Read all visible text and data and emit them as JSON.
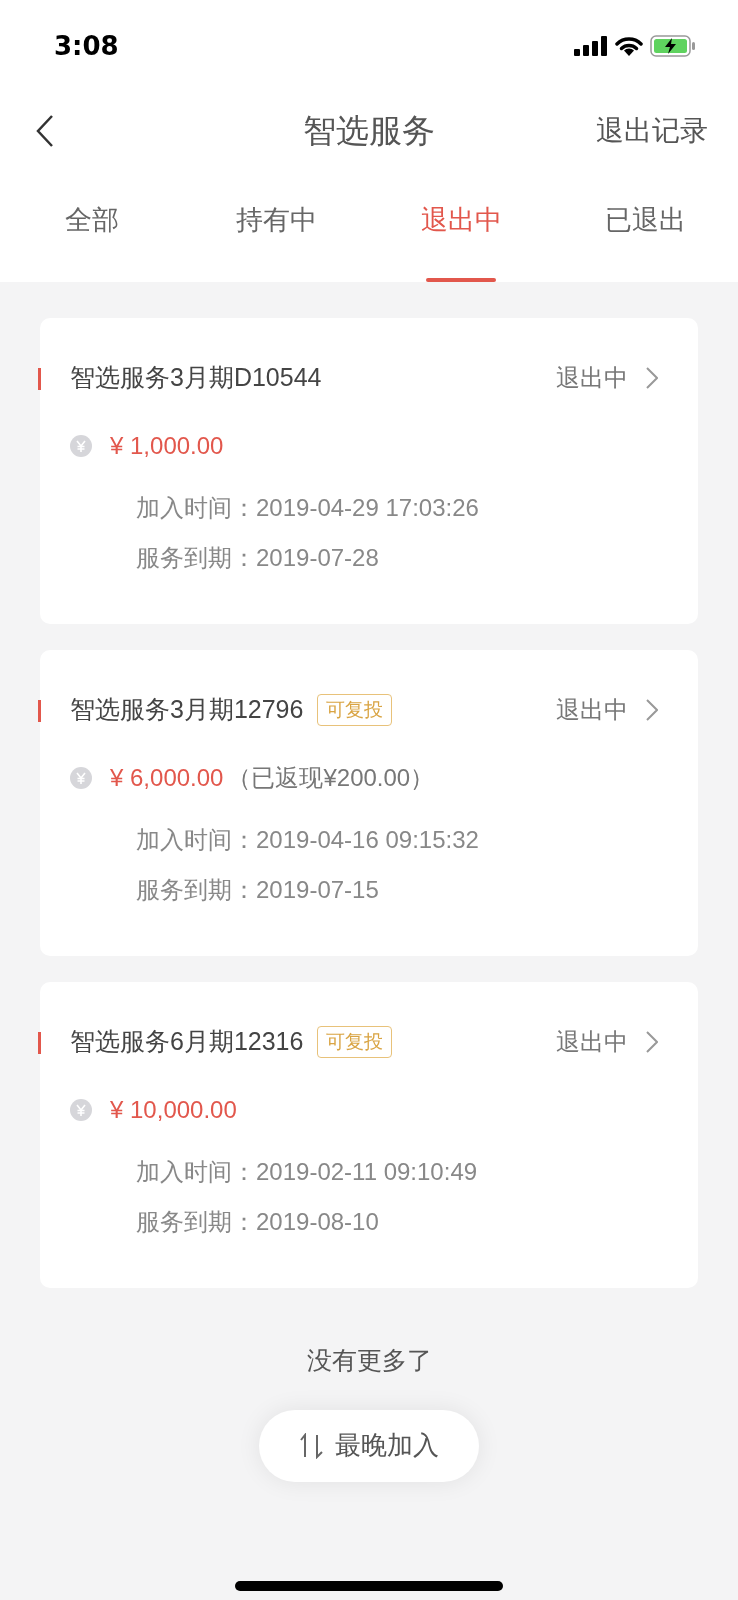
{
  "status_bar": {
    "time": "3:08"
  },
  "nav": {
    "title": "智选服务",
    "action": "退出记录"
  },
  "tabs": [
    {
      "label": "全部",
      "selected": false
    },
    {
      "label": "持有中",
      "selected": false
    },
    {
      "label": "退出中",
      "selected": true
    },
    {
      "label": "已退出",
      "selected": false
    }
  ],
  "cards": [
    {
      "title": "智选服务3月期D10544",
      "status": "退出中",
      "amount": "¥ 1,000.00",
      "join_label": "加入时间：",
      "join_time": "2019-04-29 17:03:26",
      "due_label": "服务到期：",
      "due_date": "2019-07-28"
    },
    {
      "title": "智选服务3月期12796",
      "badge": "可复投",
      "status": "退出中",
      "amount": "¥ 6,000.00",
      "cashback": "（已返现¥200.00）",
      "join_label": "加入时间：",
      "join_time": "2019-04-16 09:15:32",
      "due_label": "服务到期：",
      "due_date": "2019-07-15"
    },
    {
      "title": "智选服务6月期12316",
      "badge": "可复投",
      "status": "退出中",
      "amount": "¥ 10,000.00",
      "join_label": "加入时间：",
      "join_time": "2019-02-11 09:10:49",
      "due_label": "服务到期：",
      "due_date": "2019-08-10"
    }
  ],
  "end_text": "没有更多了",
  "sort_button": "最晚加入"
}
